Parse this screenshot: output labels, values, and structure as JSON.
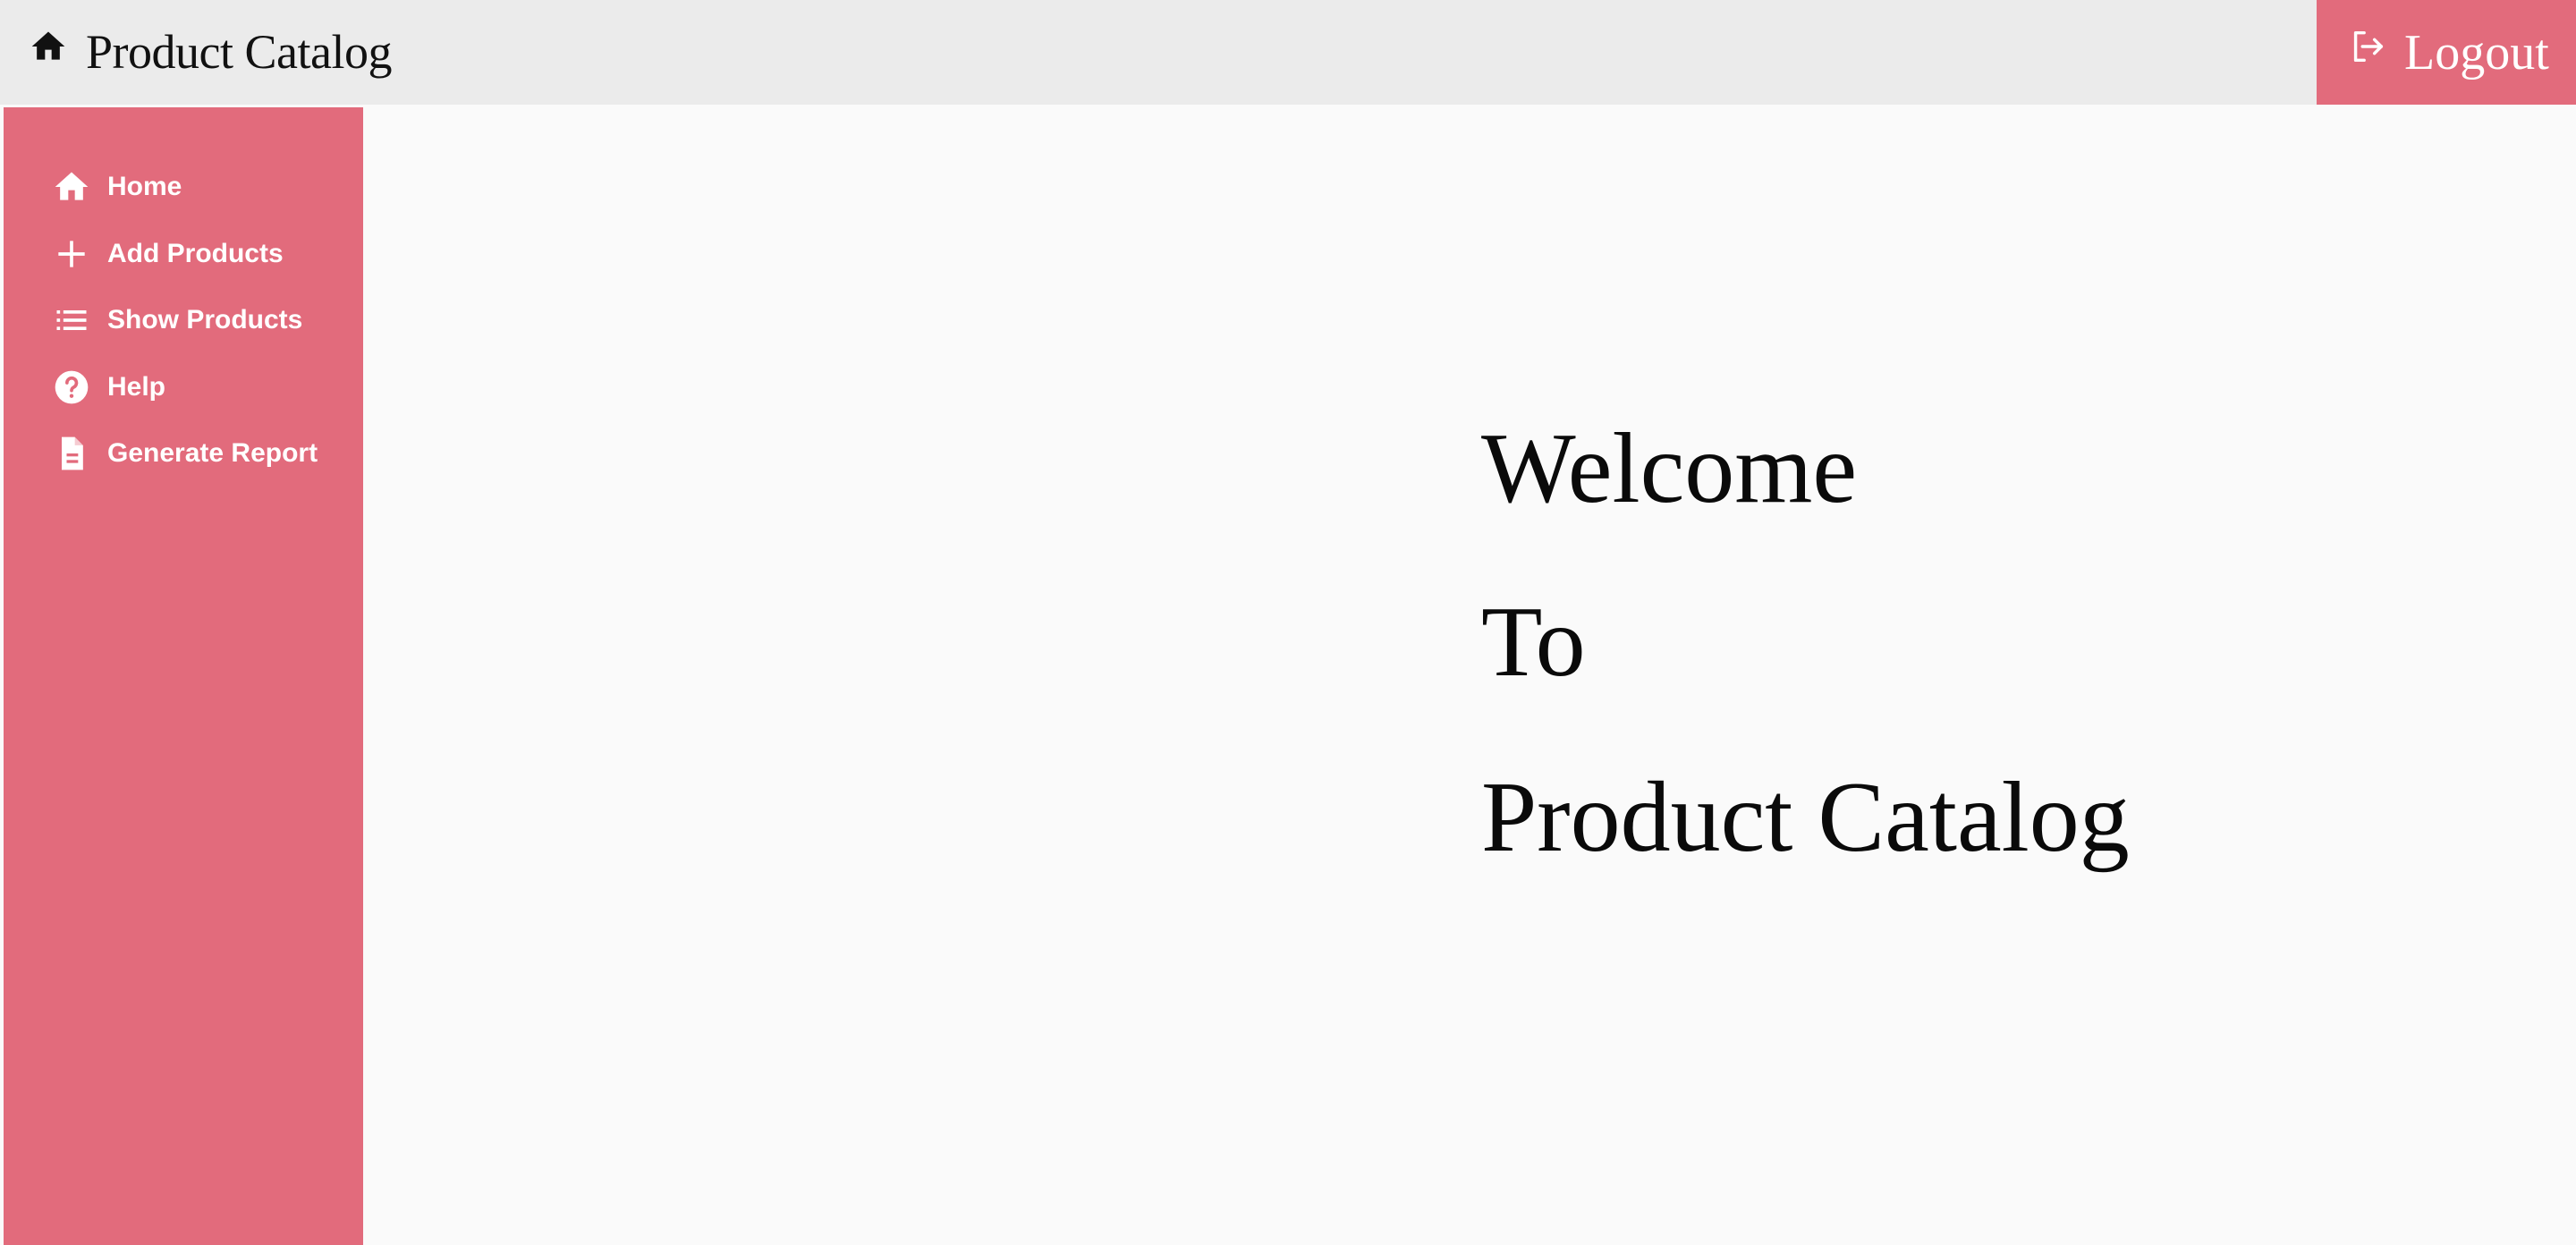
{
  "header": {
    "title": "Product Catalog",
    "logout_label": "Logout"
  },
  "sidebar": {
    "items": [
      {
        "label": "Home",
        "icon": "home-icon"
      },
      {
        "label": "Add Products",
        "icon": "plus-icon"
      },
      {
        "label": "Show Products",
        "icon": "list-icon"
      },
      {
        "label": "Help",
        "icon": "help-icon"
      },
      {
        "label": "Generate Report",
        "icon": "document-icon"
      }
    ]
  },
  "main": {
    "line1": "Welcome",
    "line2": "To",
    "line3": "Product Catalog"
  },
  "colors": {
    "accent": "#e26b7c",
    "header_bg": "#ebebeb",
    "content_bg": "#fafafa"
  }
}
